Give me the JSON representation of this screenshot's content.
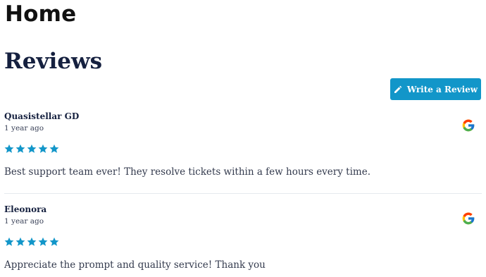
{
  "page": {
    "title": "Home"
  },
  "reviews_section": {
    "heading": "Reviews",
    "write_button_label": "Write a Review",
    "accent_color": "#1296c9",
    "star_color": "#1296c9"
  },
  "reviews": [
    {
      "name": "Quasistellar GD",
      "time": "1 year ago",
      "rating": 5,
      "text": "Best support team ever! They resolve tickets within a few hours every time.",
      "source_icon": "google-icon"
    },
    {
      "name": "Eleonora",
      "time": "1 year ago",
      "rating": 5,
      "text": "Appreciate the prompt and quality service! Thank you",
      "source_icon": "google-icon"
    }
  ]
}
